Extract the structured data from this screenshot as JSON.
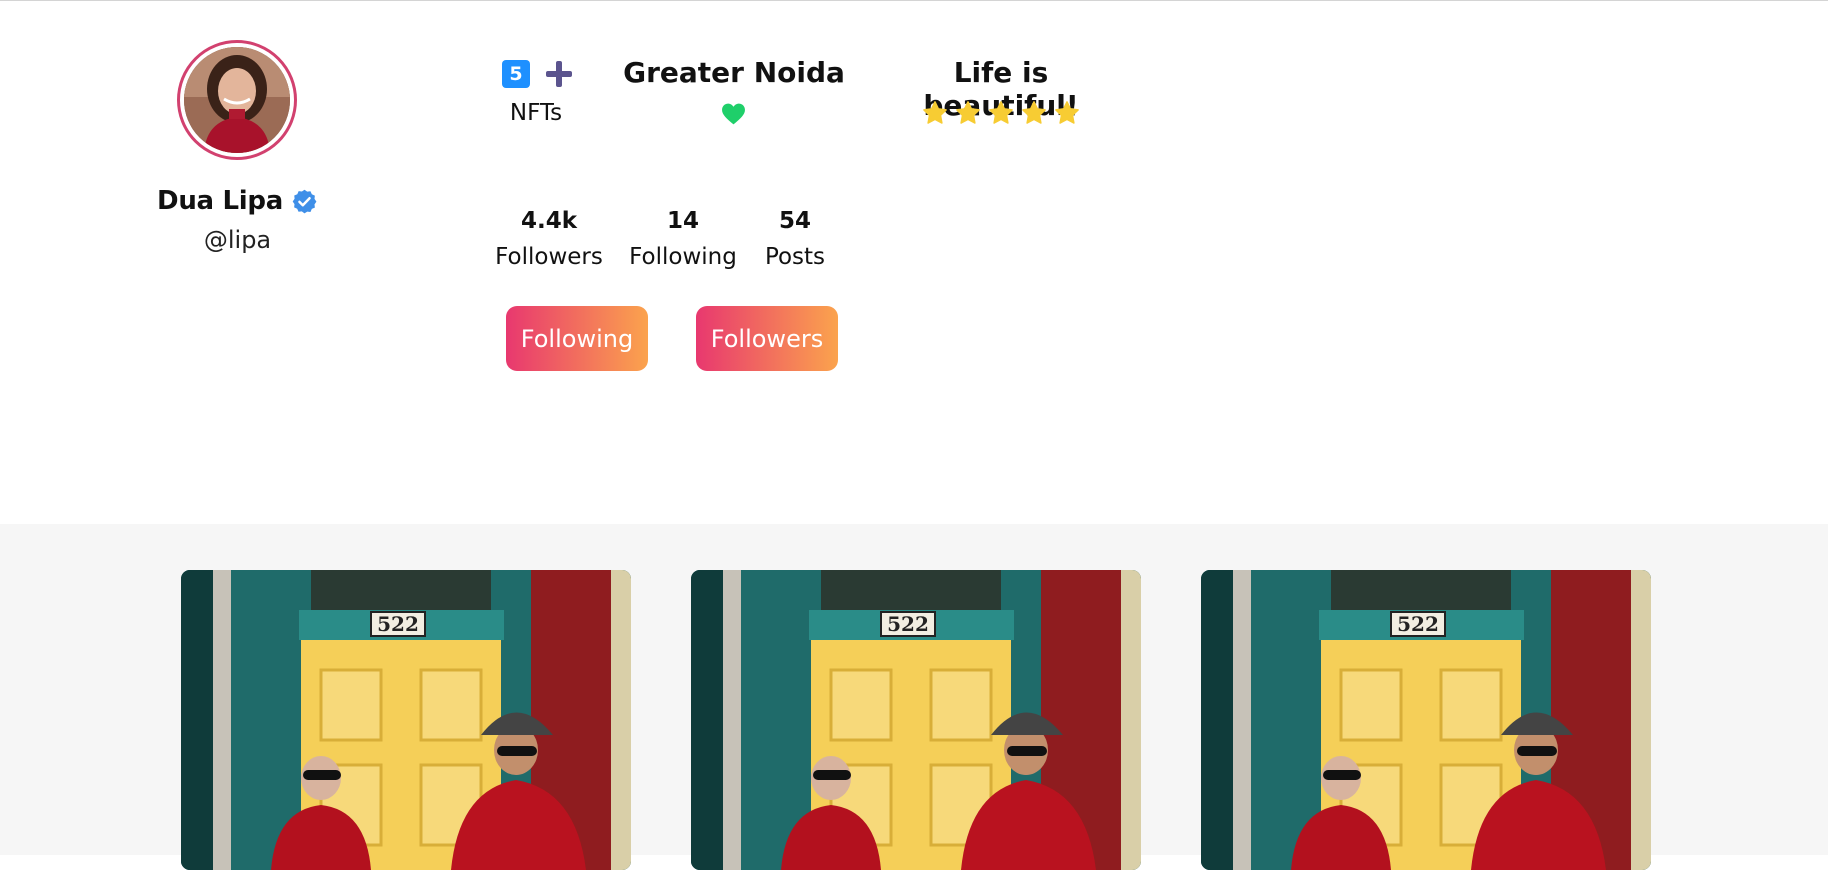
{
  "profile": {
    "name": "Dua Lipa",
    "handle": "@lipa",
    "avatar_icon": "avatar-photo",
    "verified_icon": "verified-badge-icon"
  },
  "nft": {
    "count": "5",
    "label": "NFTs",
    "plus_icon": "plus-icon"
  },
  "location": {
    "city": "Greater Noida",
    "icon": "heart-icon"
  },
  "bio": {
    "motto": "Life is beautiful!",
    "rating": 5,
    "icon": "star-icon"
  },
  "stats": [
    {
      "value": "4.4k",
      "label": "Followers"
    },
    {
      "value": "14",
      "label": "Following"
    },
    {
      "value": "54",
      "label": "Posts"
    }
  ],
  "buttons": {
    "following_label": "Following",
    "followers_label": "Followers"
  },
  "gallery": {
    "posts": [
      {
        "door_number": "522"
      },
      {
        "door_number": "522"
      },
      {
        "door_number": "522"
      }
    ]
  },
  "colors": {
    "avatar_ring": "#d2416f",
    "button_gradient_start": "#e8386f",
    "button_gradient_end": "#fba34d",
    "verified": "#3f8fe8",
    "heart": "#1fcf6a",
    "star": "#f7cc33",
    "nft_badge": "#1e90ff",
    "plus": "#5b548e",
    "gallery_bg": "#f6f6f6"
  }
}
